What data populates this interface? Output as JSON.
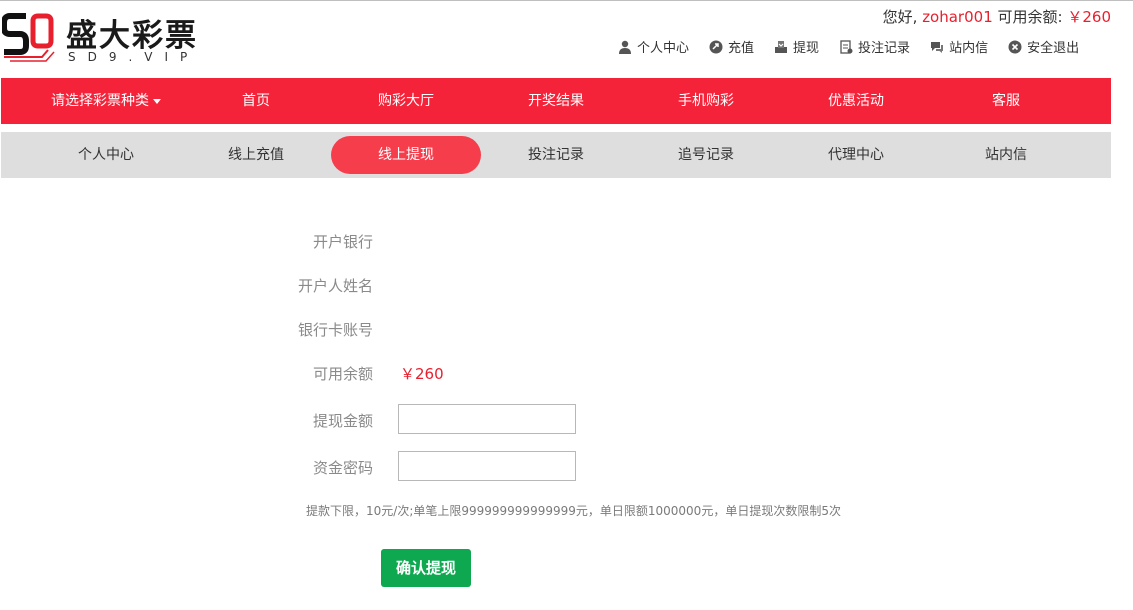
{
  "brand": {
    "name": "盛大彩票",
    "domain": "SD9.VIP"
  },
  "user": {
    "greeting": "您好,",
    "username": "zohar001",
    "balance_label": "可用余额:",
    "balance": "￥260"
  },
  "top_links": [
    {
      "label": "个人中心",
      "icon": "user-icon"
    },
    {
      "label": "充值",
      "icon": "recharge-icon"
    },
    {
      "label": "提现",
      "icon": "withdraw-icon"
    },
    {
      "label": "投注记录",
      "icon": "bet-record-icon"
    },
    {
      "label": "站内信",
      "icon": "message-icon"
    },
    {
      "label": "安全退出",
      "icon": "logout-icon"
    }
  ],
  "main_nav": [
    "请选择彩票种类",
    "首页",
    "购彩大厅",
    "开奖结果",
    "手机购彩",
    "优惠活动",
    "客服"
  ],
  "sub_nav": {
    "items": [
      "个人中心",
      "线上充值",
      "线上提现",
      "投注记录",
      "追号记录",
      "代理中心",
      "站内信"
    ],
    "active": "线上提现"
  },
  "form": {
    "bank_label": "开户银行",
    "name_label": "开户人姓名",
    "card_label": "银行卡账号",
    "balance_label": "可用余额",
    "balance_value": "￥260",
    "amount_label": "提现金额",
    "amount_value": "",
    "password_label": "资金密码",
    "password_value": "",
    "note": "提款下限，10元/次;单笔上限999999999999999元，单日限额1000000元，单日提现次数限制5次",
    "submit_label": "确认提现"
  },
  "colors": {
    "nav_red": "#f52339",
    "active_pill": "#f53d4c",
    "submit_green": "#0da84f",
    "accent_red": "#e8202e"
  }
}
